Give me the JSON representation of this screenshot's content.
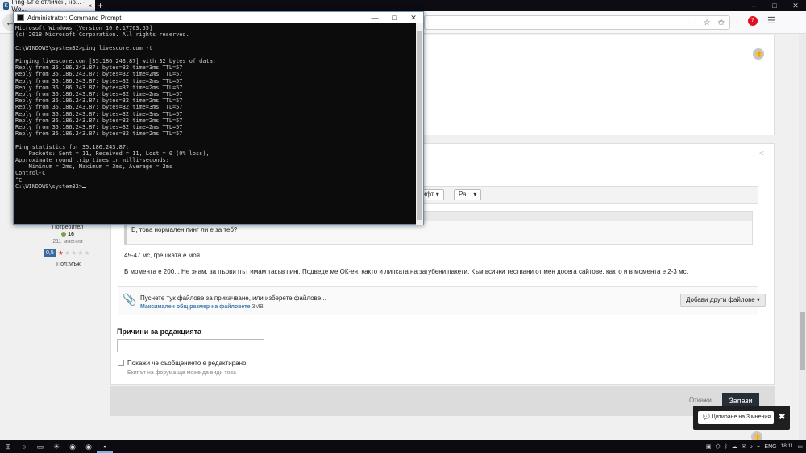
{
  "browser": {
    "tab_title": "Ping-ът е отличен, но... - Wo...",
    "tab_close": "×",
    "new_tab": "+",
    "win_min": "–",
    "win_max": "□",
    "win_close": "✕",
    "back": "←",
    "url_icons": [
      "···",
      "☆",
      "✩"
    ],
    "toolbar_badge": "7"
  },
  "cmd": {
    "title": "Administrator: Command Prompt",
    "min": "—",
    "max": "□",
    "close": "✕",
    "lines": [
      "Microsoft Windows [Version 10.0.17763.55]",
      "(c) 2018 Microsoft Corporation. All rights reserved.",
      "",
      "C:\\WINDOWS\\system32>ping livescore.com -t",
      "",
      "Pinging livescore.com [35.186.243.87] with 32 bytes of data:",
      "Reply from 35.186.243.87: bytes=32 time=3ms TTL=57",
      "Reply from 35.186.243.87: bytes=32 time=2ms TTL=57",
      "Reply from 35.186.243.87: bytes=32 time=2ms TTL=57",
      "Reply from 35.186.243.87: bytes=32 time=2ms TTL=57",
      "Reply from 35.186.243.87: bytes=32 time=2ms TTL=57",
      "Reply from 35.186.243.87: bytes=32 time=2ms TTL=57",
      "Reply from 35.186.243.87: bytes=32 time=3ms TTL=57",
      "Reply from 35.186.243.87: bytes=32 time=3ms TTL=57",
      "Reply from 35.186.243.87: bytes=32 time=2ms TTL=57",
      "Reply from 35.186.243.87: bytes=32 time=2ms TTL=57",
      "Reply from 35.186.243.87: bytes=32 time=2ms TTL=57",
      "",
      "Ping statistics for 35.186.243.87:",
      "    Packets: Sent = 11, Received = 11, Lost = 0 (0% loss),",
      "Approximate round trip times in milli-seconds:",
      "    Minimum = 2ms, Maximum = 3ms, Average = 2ms",
      "Control-C",
      "^C"
    ],
    "prompt": "C:\\WINDOWS\\system32>"
  },
  "author": {
    "role": "Потребител",
    "points": "16",
    "posts": "211 мнения",
    "rating": "0,5",
    "stars": [
      "★",
      "★",
      "★",
      "★",
      "★"
    ],
    "gender": "Пол:Мъж"
  },
  "editor": {
    "toolbar_btn1": "ифт ▾",
    "toolbar_btn2": "Ра... ▾",
    "quote_text": "Е, това нормален пинг ли е за теб?",
    "para1": "45-47 мс, грешката е моя.",
    "para2": "В момента е 200... Не знам, за първи път имам такъв пинг. Подведе ме ОК-ея, както и липсата на загубени пакети. Към всички тествани от мен досега сайтове, както и в момента е 2-3 мс.",
    "attach_main": "Пуснете тук файлове за прикачване, или изберете файлове...",
    "attach_size_label": "Максимален общ размер на файловете",
    "attach_size_value": "3MB",
    "add_files": "Добави други файлове ▾",
    "reason_label": "Причини за редакцията",
    "show_edited": "Покажи че съобщението е редактирано",
    "show_edited_hint": "Екипът на форума ще може да види това",
    "cancel": "Откажи",
    "save": "Запази"
  },
  "toast": {
    "label": "Цитиране на 3 мнения",
    "close": "✖"
  },
  "taskbar": {
    "items": [
      "⊞",
      "○",
      "▭",
      "☀",
      "◉",
      "◉",
      "▪"
    ],
    "lang": "ENG",
    "time": "18:11",
    "tray_icons": [
      "▣",
      "⬡",
      "ᛒ",
      "☁",
      "✉",
      "♪",
      "⌁"
    ]
  }
}
